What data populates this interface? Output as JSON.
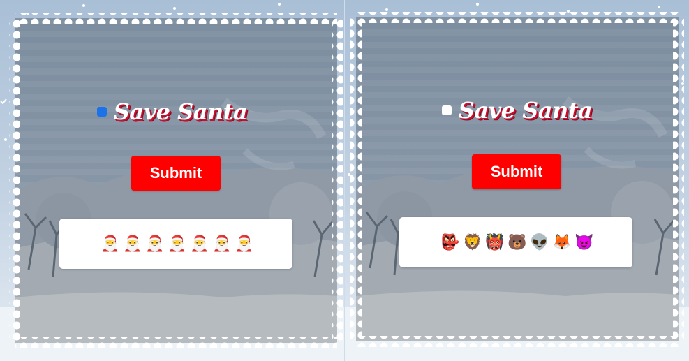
{
  "panels": [
    {
      "checkbox_checked": true,
      "title": "Save Santa",
      "submit_label": "Submit",
      "emojis": [
        "🎅",
        "🎅",
        "🎅",
        "🎅",
        "🎅",
        "🎅",
        "🎅"
      ],
      "emoji_names": [
        "santa-icon",
        "santa-icon",
        "santa-icon",
        "santa-icon",
        "santa-icon",
        "santa-icon",
        "santa-icon"
      ]
    },
    {
      "checkbox_checked": false,
      "title": "Save Santa",
      "submit_label": "Submit",
      "emojis": [
        "👺",
        "🦁",
        "👹",
        "🐻",
        "👽",
        "🦊",
        "😈"
      ],
      "emoji_names": [
        "goblin-icon",
        "lion-icon",
        "ogre-icon",
        "bear-icon",
        "alien-icon",
        "fox-icon",
        "devil-icon"
      ]
    }
  ],
  "colors": {
    "button": "#ff0000",
    "title_shadow": "#c8102e",
    "checkbox_checked": "#1a73e8"
  }
}
